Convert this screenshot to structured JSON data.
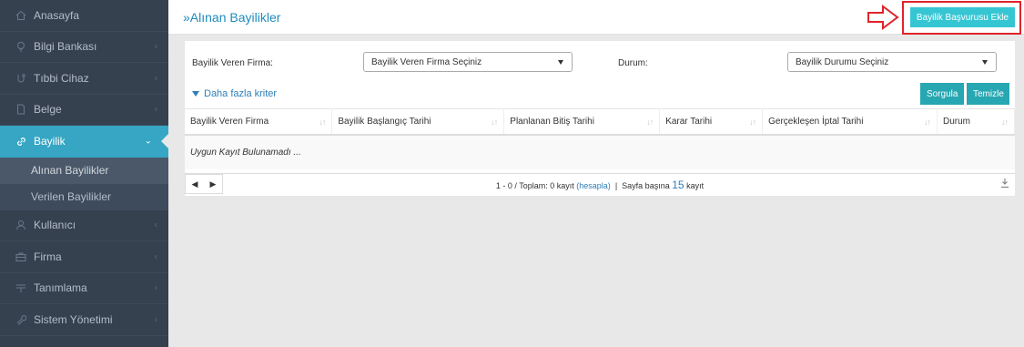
{
  "sidebar": {
    "items": [
      {
        "label": "Anasayfa",
        "icon": "home-icon"
      },
      {
        "label": "Bilgi Bankası",
        "icon": "bulb-icon"
      },
      {
        "label": "Tıbbi Cihaz",
        "icon": "device-icon"
      },
      {
        "label": "Belge",
        "icon": "document-icon"
      },
      {
        "label": "Bayilik",
        "icon": "link-icon"
      },
      {
        "label": "Kullanıcı",
        "icon": "user-icon"
      },
      {
        "label": "Firma",
        "icon": "briefcase-icon"
      },
      {
        "label": "Tanımlama",
        "icon": "layers-icon"
      },
      {
        "label": "Sistem Yönetimi",
        "icon": "wrench-icon"
      }
    ],
    "submenu": [
      {
        "label": "Alınan Bayilikler"
      },
      {
        "label": "Verilen Bayilikler"
      }
    ]
  },
  "header": {
    "title": "»Alınan Bayilikler",
    "add_button": "Bayilik Başvurusu Ekle"
  },
  "filters": {
    "firm_label": "Bayilik Veren Firma:",
    "firm_select": "Bayilik Veren Firma Seçiniz",
    "status_label": "Durum:",
    "status_select": "Bayilik Durumu Seçiniz",
    "more_criteria": "Daha fazla kriter",
    "query_button": "Sorgula",
    "clear_button": "Temizle"
  },
  "table": {
    "columns": [
      "Bayilik Veren Firma",
      "Bayilik Başlangıç Tarihi",
      "Planlanan Bitiş Tarihi",
      "Karar Tarihi",
      "Gerçekleşen İptal Tarihi",
      "Durum"
    ],
    "empty_message": "Uygun Kayıt Bulunamadı ..."
  },
  "pager": {
    "prev": "◀",
    "next": "▶",
    "summary": "1 - 0 / Toplam: 0 kayıt",
    "calc_link": "(hesapla)",
    "separator": "|",
    "per_page_label": "Sayfa başına",
    "per_page_value": "15",
    "unit": "kayıt"
  },
  "colors": {
    "sidebar_bg": "#364150",
    "active_bg": "#36a6c4",
    "accent": "#36c6d3",
    "title": "#1e8bbd",
    "highlight": "#e0242a"
  }
}
